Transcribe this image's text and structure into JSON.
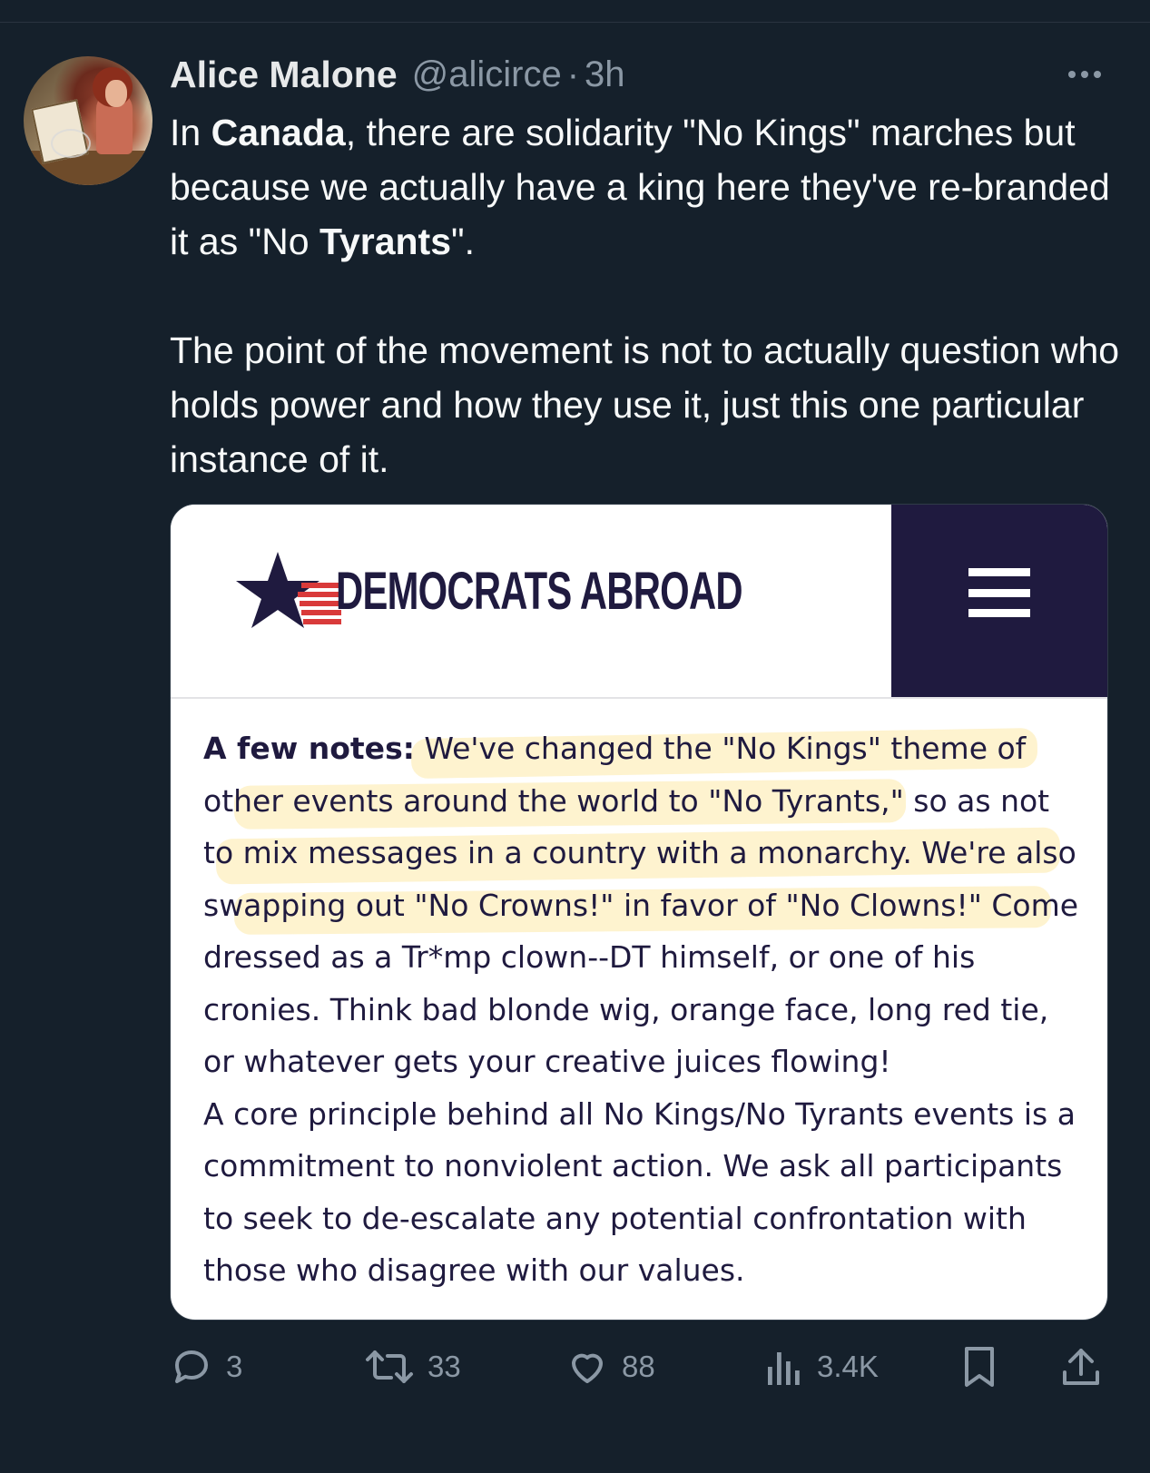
{
  "tweet": {
    "author_name": "Alice Malone",
    "handle": "@alicirce",
    "separator": "·",
    "time": "3h",
    "avatar_icon": "avatar-painting",
    "more_icon": "more-horizontal-icon",
    "paragraph1": {
      "t1": "In ",
      "b1": "Canada",
      "t2": ", there are solidarity \"No Kings\" marches but because we actually have a king here they've re-branded it as \"No ",
      "b2": "Tyrants",
      "t3": "\"."
    },
    "paragraph2": "The point of the movement is not to actually question who holds power and how they use it, just this one particular instance of it."
  },
  "card": {
    "logo_text": "DEMOCRATS ABROAD",
    "menu_icon": "hamburger-menu-icon",
    "notes_label": "A few notes:",
    "notes_text": " We've changed the \"No Kings\" theme of other events around the world to \"No Tyrants,\" so as not to mix messages in a country with a monarchy. We're also swapping out \"No Crowns!\" in favor of \"No Clowns!\" Come dressed as a Tr*mp clown--DT himself, or one of his cronies. Think bad blonde wig, orange face, long red tie, or whatever gets your creative juices flowing!",
    "principle_text": "A core principle behind all No Kings/No Tyrants events is a commitment to nonviolent action. We ask all participants to seek to de-escalate any potential confrontation with those who disagree with our values.",
    "colors": {
      "navy": "#1f1a3f",
      "red": "#d93a3a",
      "highlight": "#fde9a8"
    }
  },
  "actions": {
    "reply_count": "3",
    "retweet_count": "33",
    "like_count": "88",
    "views_count": "3.4K",
    "icons": [
      "reply-icon",
      "retweet-icon",
      "like-icon",
      "views-icon",
      "bookmark-icon",
      "share-icon"
    ]
  },
  "colors": {
    "background": "#15202b",
    "text": "#e7e9ea",
    "muted": "#8b98a5"
  }
}
